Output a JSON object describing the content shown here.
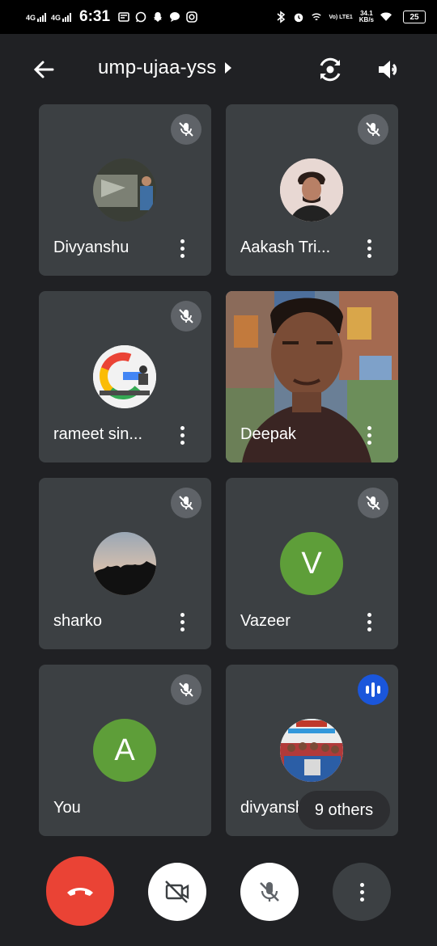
{
  "status_bar": {
    "net1": "4G",
    "net2": "4G",
    "time": "6:31",
    "volte": "Vo) LTE1",
    "speed_value": "34.1",
    "speed_unit": "KB/s",
    "battery": "25"
  },
  "header": {
    "meeting_code": "ump-ujaa-yss"
  },
  "participants": [
    {
      "name": "Divyanshu",
      "muted": true
    },
    {
      "name": "Aakash Tri...",
      "muted": true
    },
    {
      "name": "rameet sin...",
      "muted": true
    },
    {
      "name": "Deepak",
      "video": true
    },
    {
      "name": "sharko",
      "muted": true
    },
    {
      "name": "Vazeer",
      "muted": true,
      "initial": "V",
      "color": "#5e9e39"
    },
    {
      "name": "You",
      "muted": true,
      "initial": "A",
      "color": "#5e9e39"
    },
    {
      "name": "divyansh",
      "speaking": true
    }
  ],
  "others_label": "9 others",
  "controls": {
    "hangup": "end-call",
    "camera": "camera-off",
    "microphone": "mic-off",
    "more": "more-options"
  },
  "colors": {
    "background": "#202124",
    "tile": "#3c4043",
    "hangup": "#ea4335",
    "speaking": "#1a56db"
  }
}
